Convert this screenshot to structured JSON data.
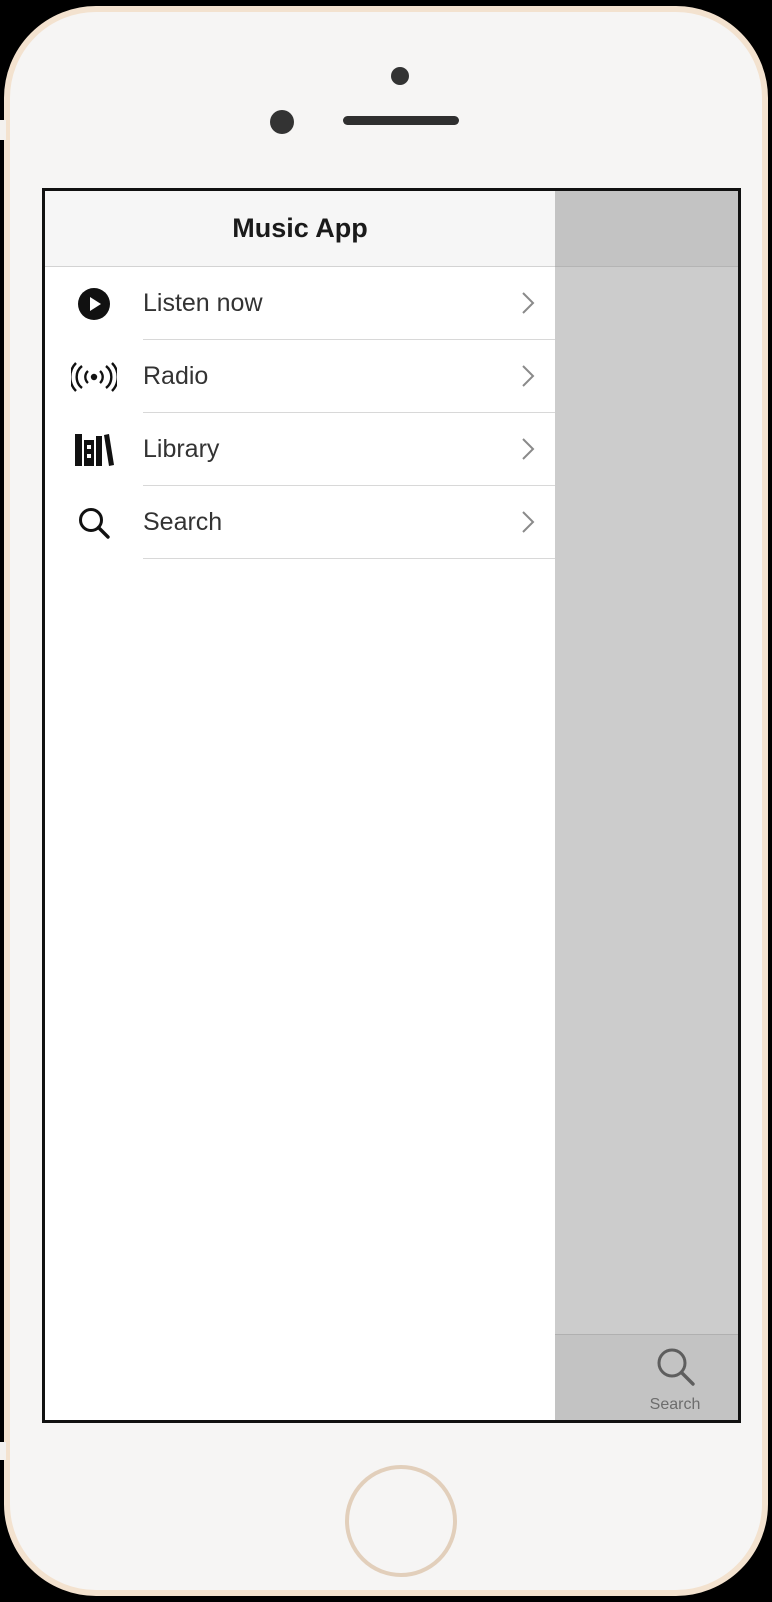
{
  "app": {
    "title": "Music App"
  },
  "menu": {
    "items": [
      {
        "label": "Listen now",
        "icon": "play-circle-icon"
      },
      {
        "label": "Radio",
        "icon": "radio-broadcast-icon"
      },
      {
        "label": "Library",
        "icon": "library-icon"
      },
      {
        "label": "Search",
        "icon": "search-icon"
      }
    ]
  },
  "tabbar": {
    "search_label": "Search"
  },
  "colors": {
    "overlay": "#cccccc",
    "header_bg": "#f6f6f6",
    "text": "#333333",
    "frame": "#f3e2cf"
  }
}
